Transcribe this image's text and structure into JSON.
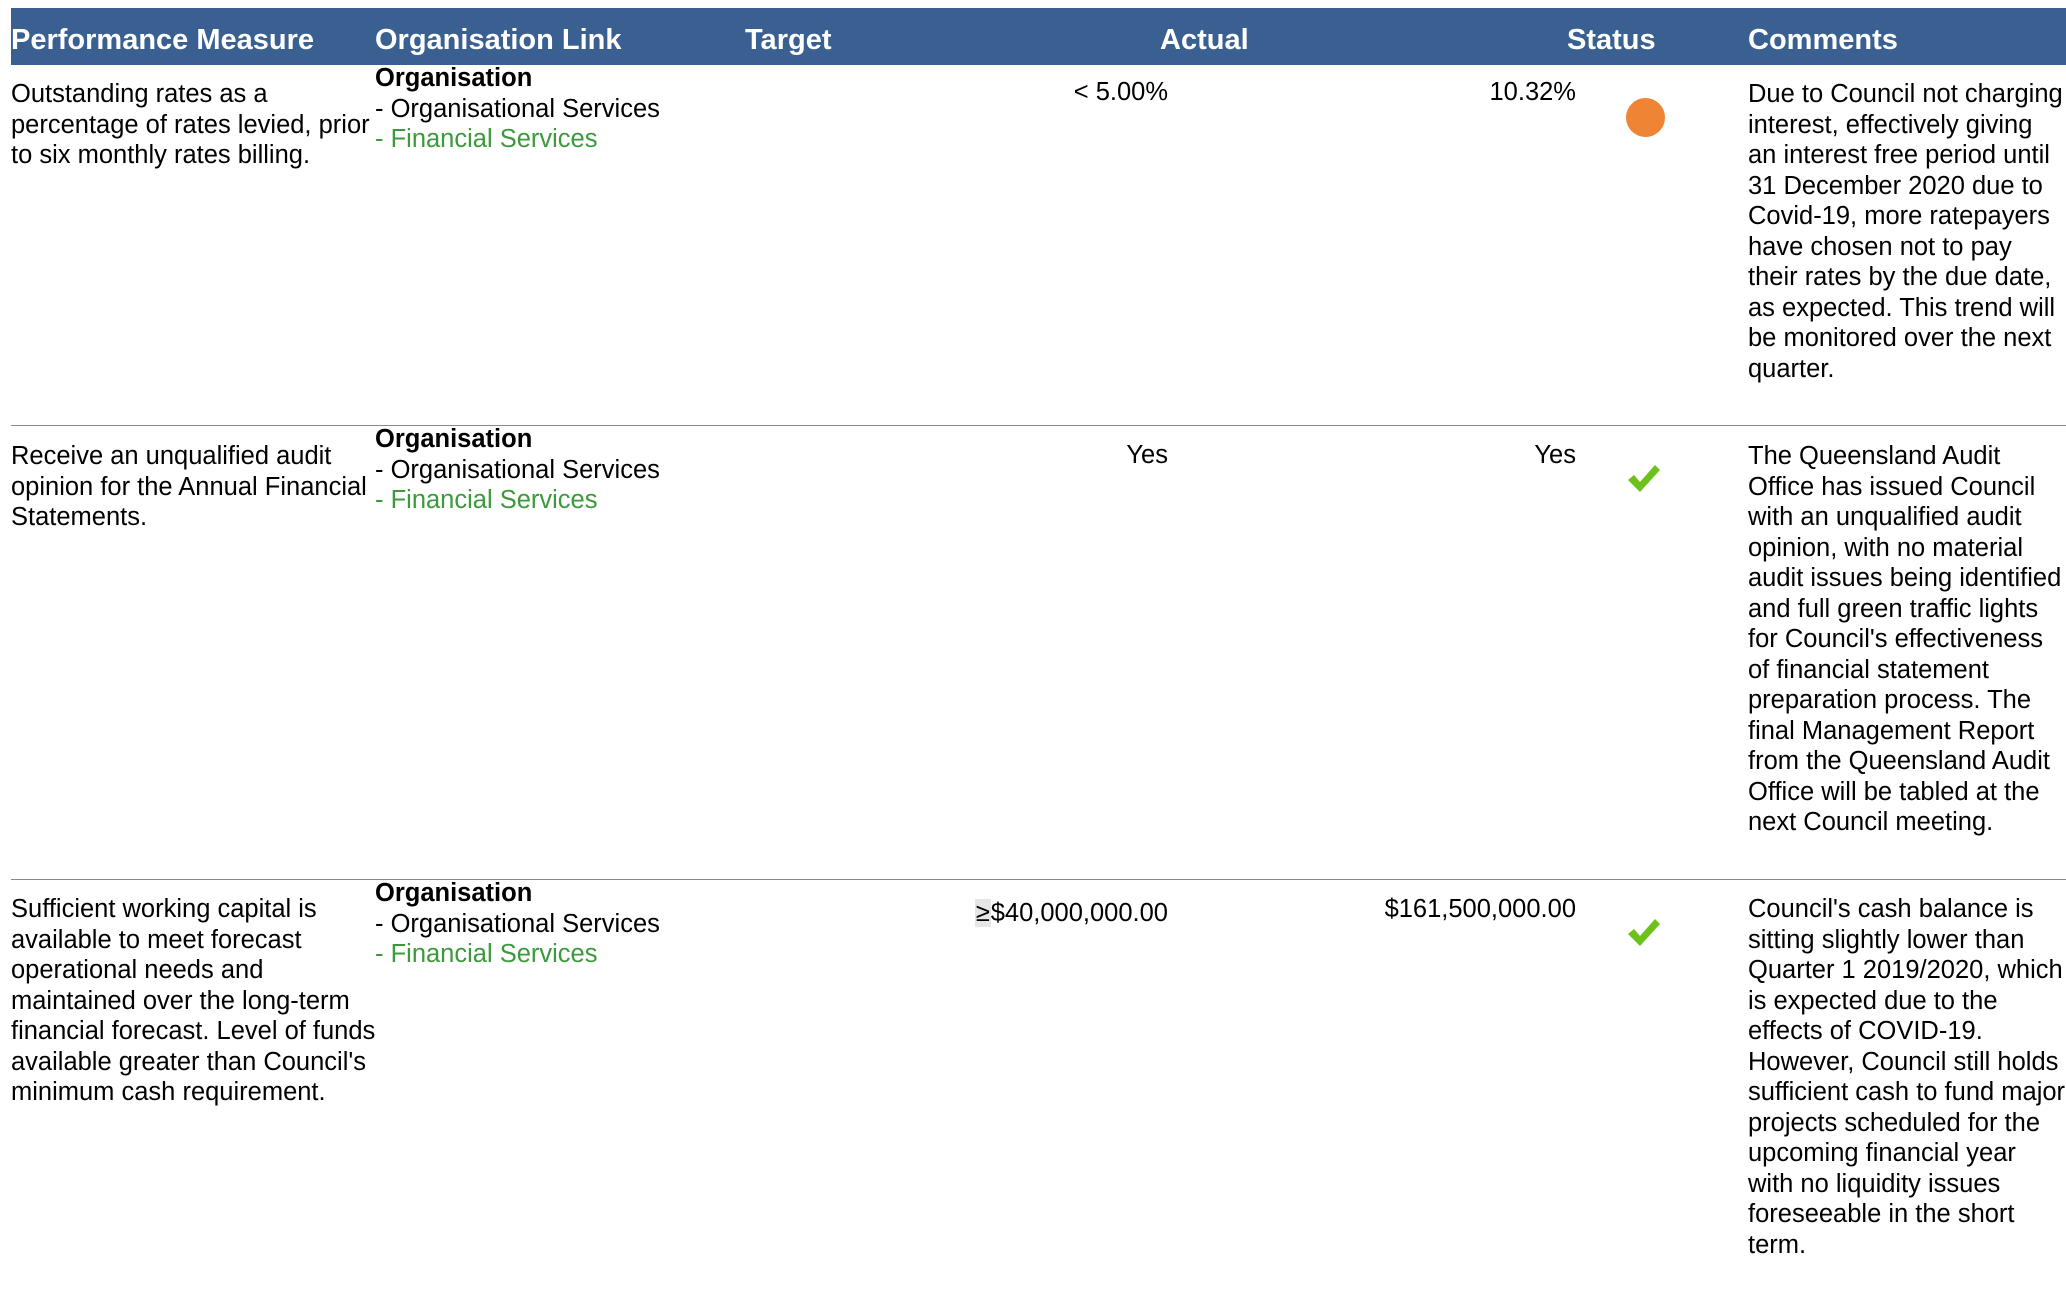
{
  "header": {
    "performance_measure": "Performance Measure",
    "organisation_link": "Organisation Link",
    "target": "Target",
    "actual": "Actual",
    "status": "Status",
    "comments": "Comments"
  },
  "rows": [
    {
      "measure": "Outstanding rates as a percentage of rates levied, prior to six monthly rates billing.",
      "org_title": "Organisation",
      "org_line1": "- Organisational Services",
      "org_line2": "- Financial Services",
      "target": "< 5.00%",
      "actual": "10.32%",
      "status_icon": "orange-circle-icon",
      "comments": "Due to Council not charging interest, effectively giving an interest free period until 31 December 2020 due to Covid-19, more ratepayers have chosen not to pay their rates by the due date, as expected. This trend will be monitored over the next quarter."
    },
    {
      "measure": "Receive an unqualified audit opinion for the Annual Financial Statements.",
      "org_title": "Organisation",
      "org_line1": "- Organisational Services",
      "org_line2": "- Financial Services",
      "target": "Yes",
      "actual": "Yes",
      "status_icon": "green-check-icon",
      "comments": "The Queensland Audit Office has issued Council with an unqualified audit opinion, with no material audit issues being identified and full green traffic lights for Council's effectiveness of financial statement preparation process. The final Management Report from the Queensland Audit Office will be tabled at the next Council meeting."
    },
    {
      "measure": "Sufficient working capital is available to meet forecast operational needs and maintained over the long-term financial forecast. Level of funds available greater than Council's minimum cash requirement.",
      "org_title": "Organisation",
      "org_line1": "- Organisational Services",
      "org_line2": "- Financial Services",
      "target_symbol": "≥",
      "target": "$40,000,000.00",
      "actual": "$161,500,000.00",
      "status_icon": "green-check-icon",
      "comments": "Council's cash balance is sitting slightly lower than Quarter 1 2019/2020, which is expected due to the effects of COVID-19. However, Council still holds sufficient cash to fund major projects scheduled for the upcoming financial year with no liquidity issues foreseeable in the short term."
    }
  ],
  "colors": {
    "header_bg": "#3a6091",
    "header_text": "#ffffff",
    "org_green": "#3c9a3c",
    "status_orange": "#ee8434",
    "status_green": "#6cc21b",
    "divider": "#8a8a8a"
  }
}
